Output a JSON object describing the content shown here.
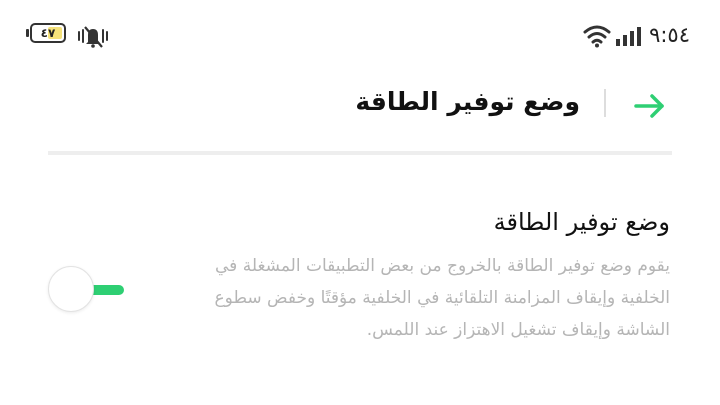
{
  "status_bar": {
    "time": "٩:٥٤",
    "battery_level": "٤٧",
    "icons": [
      "wifi-icon",
      "signal-icon",
      "battery-icon",
      "vibrate-mute-icon"
    ]
  },
  "toolbar": {
    "title": "وضع توفير الطاقة",
    "back_icon": "arrow-back-icon"
  },
  "setting": {
    "title": "وضع توفير الطاقة",
    "description": "يقوم وضع توفير الطاقة بالخروج من بعض التطبيقات المشغلة في الخلفية وإيقاف المزامنة التلقائية في الخلفية مؤقتًا وخفض سطوع الشاشة وإيقاف تشغيل الاهتزاز عند اللمس.",
    "enabled": false
  },
  "colors": {
    "accent": "#2ecf73",
    "description_text": "#b5b5b5",
    "separator": "#eeeeee"
  }
}
